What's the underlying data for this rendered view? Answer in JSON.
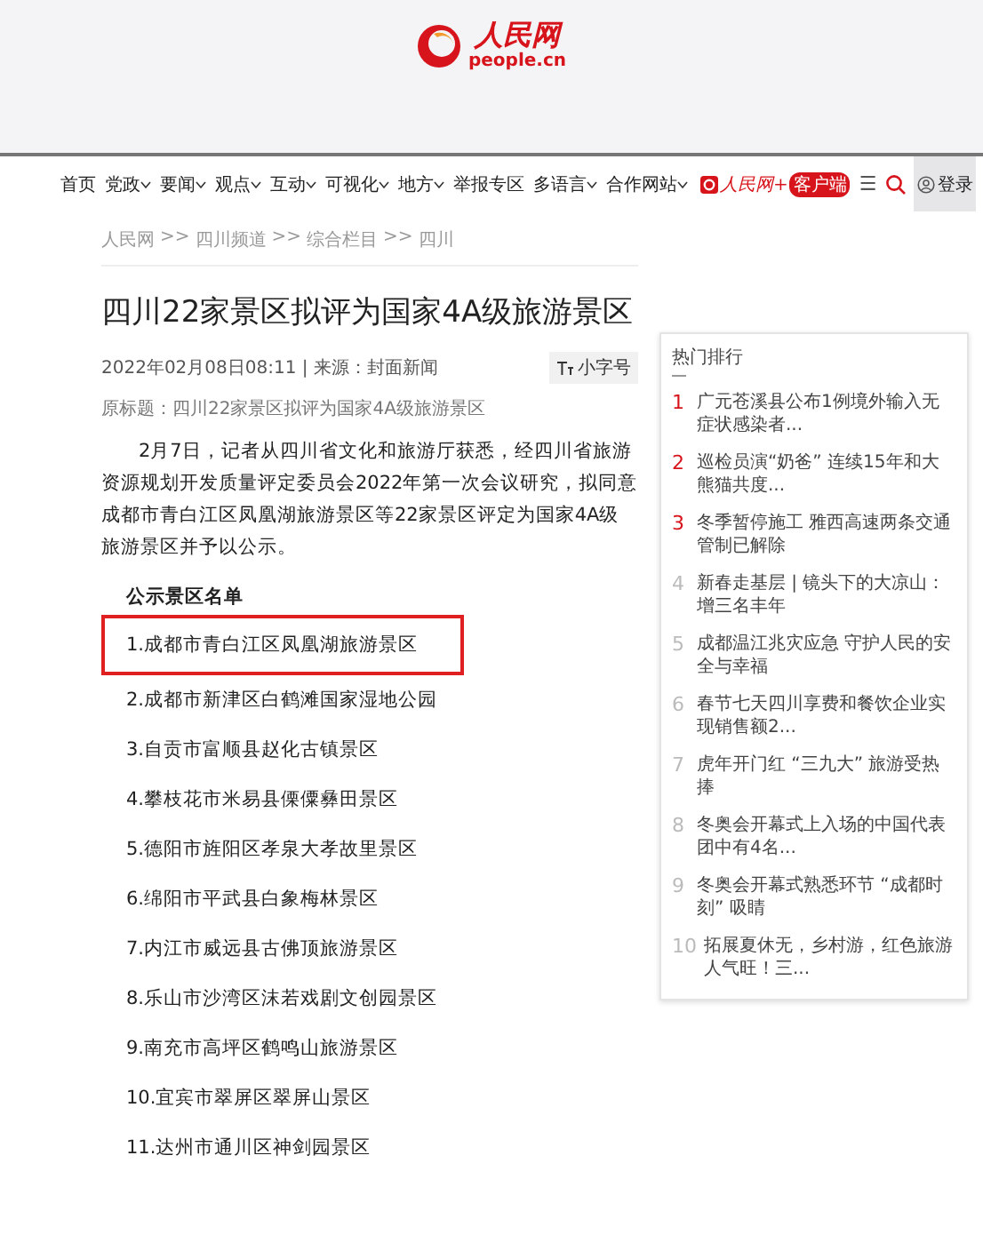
{
  "header": {
    "logo_text": "人民网",
    "logo_domain": "people.cn"
  },
  "nav": {
    "items": [
      {
        "label": "首页",
        "dropdown": false
      },
      {
        "label": "党政",
        "dropdown": true
      },
      {
        "label": "要闻",
        "dropdown": true
      },
      {
        "label": "观点",
        "dropdown": true
      },
      {
        "label": "互动",
        "dropdown": true
      },
      {
        "label": "可视化",
        "dropdown": true
      },
      {
        "label": "地方",
        "dropdown": true
      },
      {
        "label": "举报专区",
        "dropdown": false
      },
      {
        "label": "多语言",
        "dropdown": true
      },
      {
        "label": "合作网站",
        "dropdown": true
      }
    ],
    "app_label": "人民网+",
    "app_badge": "客户端",
    "menu_glyph": "☰",
    "login": "登录"
  },
  "breadcrumbs": [
    "人民网",
    "四川频道",
    "综合栏目",
    "四川"
  ],
  "breadcrumb_separator": ">>",
  "article": {
    "title": "四川22家景区拟评为国家4A级旅游景区",
    "meta": "2022年02月08日08:11 | 来源：封面新闻",
    "font_toggle": "小字号",
    "original_title": "原标题：四川22家景区拟评为国家4A级旅游景区",
    "paragraph": "2月7日，记者从四川省文化和旅游厅获悉，经四川省旅游资源规划开发质量评定委员会2022年第一次会议研究，拟同意成都市青白江区凤凰湖旅游景区等22家景区评定为国家4A级旅游景区并予以公示。",
    "list_heading": "公示景区名单",
    "list": [
      {
        "text": "1.成都市青白江区凤凰湖旅游景区",
        "highlighted": true
      },
      {
        "text": "2.成都市新津区白鹤滩国家湿地公园",
        "highlighted": false
      },
      {
        "text": "3.自贡市富顺县赵化古镇景区",
        "highlighted": false
      },
      {
        "text": "4.攀枝花市米易县傈僳彝田景区",
        "highlighted": false
      },
      {
        "text": "5.德阳市旌阳区孝泉大孝故里景区",
        "highlighted": false
      },
      {
        "text": "6.绵阳市平武县白象梅林景区",
        "highlighted": false
      },
      {
        "text": "7.内江市威远县古佛顶旅游景区",
        "highlighted": false
      },
      {
        "text": "8.乐山市沙湾区沫若戏剧文创园景区",
        "highlighted": false
      },
      {
        "text": "9.南充市高坪区鹤鸣山旅游景区",
        "highlighted": false
      },
      {
        "text": "10.宜宾市翠屏区翠屏山景区",
        "highlighted": false
      },
      {
        "text": "11.达州市通川区神剑园景区",
        "highlighted": false
      }
    ]
  },
  "sidebar": {
    "title": "热门排行",
    "items": [
      {
        "rank": "1",
        "text": "广元苍溪县公布1例境外输入无症状感染者...",
        "top": true
      },
      {
        "rank": "2",
        "text": "巡检员演“奶爸” 连续15年和大熊猫共度...",
        "top": true
      },
      {
        "rank": "3",
        "text": "冬季暂停施工 雅西高速两条交通管制已解除",
        "top": true
      },
      {
        "rank": "4",
        "text": "新春走基层 | 镜头下的大凉山：增三名丰年",
        "top": false
      },
      {
        "rank": "5",
        "text": "成都温江兆灾应急 守护人民的安全与幸福",
        "top": false
      },
      {
        "rank": "6",
        "text": "春节七天四川享费和餐饮企业实现销售额2...",
        "top": false
      },
      {
        "rank": "7",
        "text": "虎年开门红 “三九大” 旅游受热捧",
        "top": false
      },
      {
        "rank": "8",
        "text": "冬奥会开幕式上入场的中国代表团中有4名...",
        "top": false
      },
      {
        "rank": "9",
        "text": "冬奥会开幕式熟悉环节 “成都时刻” 吸睛",
        "top": false
      },
      {
        "rank": "10",
        "text": "拓展夏休无，乡村游，红色旅游人气旺！三...",
        "top": false
      }
    ]
  }
}
